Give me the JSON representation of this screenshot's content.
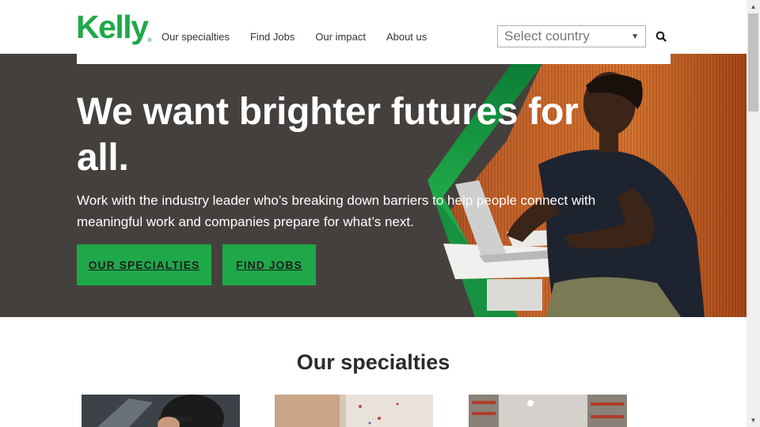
{
  "header": {
    "logo": "Kelly",
    "logo_mark": "®",
    "nav": [
      {
        "label": "Our specialties"
      },
      {
        "label": "Find Jobs"
      },
      {
        "label": "Our impact"
      },
      {
        "label": "About us"
      }
    ],
    "country_select": {
      "value": "Select country"
    },
    "search_icon": "search-icon"
  },
  "hero": {
    "title_line1": "We want brighter futures for",
    "title_line2": "all.",
    "subtitle": "Work with the industry leader who’s breaking down barriers to help people connect with meaningful work and companies prepare for what’s next.",
    "buttons": [
      {
        "label": "OUR SPECIALTIES"
      },
      {
        "label": "FIND JOBS"
      }
    ],
    "colors": {
      "accent": "#1fa84a",
      "background": "#44403d"
    }
  },
  "specialties": {
    "title": "Our specialties"
  }
}
